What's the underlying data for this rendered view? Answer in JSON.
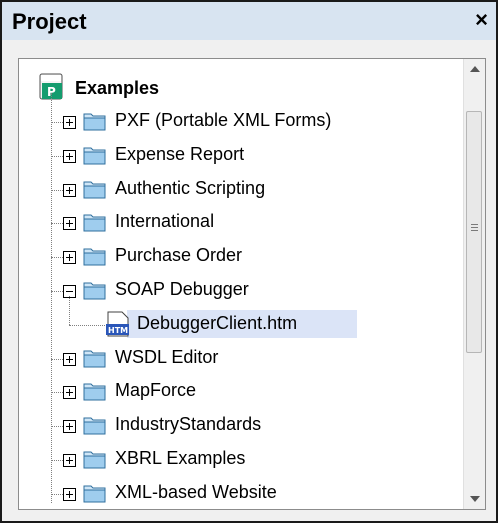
{
  "window": {
    "title": "Project",
    "close_glyph": "×"
  },
  "tree": {
    "root": {
      "label": "Examples",
      "icon": "project-icon"
    },
    "items": [
      {
        "label": "PXF (Portable XML Forms)",
        "expanded": false
      },
      {
        "label": "Expense Report",
        "expanded": false
      },
      {
        "label": "Authentic Scripting",
        "expanded": false
      },
      {
        "label": "International",
        "expanded": false
      },
      {
        "label": "Purchase Order",
        "expanded": false
      },
      {
        "label": "SOAP Debugger",
        "expanded": true,
        "children": [
          {
            "label": "DebuggerClient.htm",
            "icon": "htm-file-icon",
            "selected": true
          }
        ]
      },
      {
        "label": "WSDL Editor",
        "expanded": false
      },
      {
        "label": "MapForce",
        "expanded": false
      },
      {
        "label": "IndustryStandards",
        "expanded": false
      },
      {
        "label": "XBRL Examples",
        "expanded": false
      },
      {
        "label": "XML-based Website",
        "expanded": false
      }
    ]
  },
  "colors": {
    "titlebar": "#d8e4f1",
    "selection": "#dbe4f7",
    "folder": "#2f8fd0"
  }
}
